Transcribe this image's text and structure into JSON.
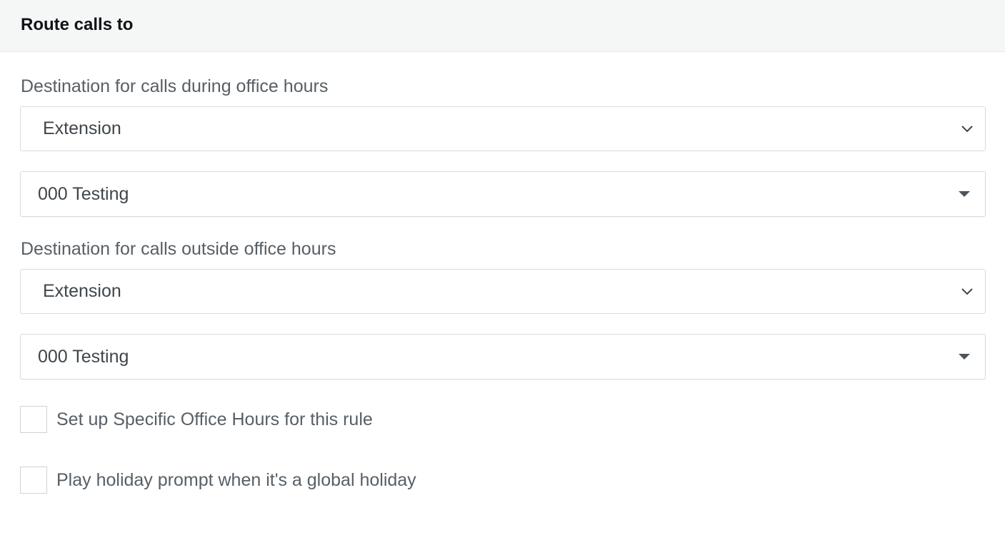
{
  "header": {
    "title": "Route calls to"
  },
  "office_hours": {
    "label": "Destination for calls during office hours",
    "type_value": "Extension",
    "target_value": "000 Testing"
  },
  "outside_hours": {
    "label": "Destination for calls outside office hours",
    "type_value": "Extension",
    "target_value": "000 Testing"
  },
  "options": {
    "specific_hours_label": "Set up Specific Office Hours for this rule",
    "specific_hours_checked": false,
    "holiday_prompt_label": "Play holiday prompt when it's a global holiday",
    "holiday_prompt_checked": false
  },
  "icons": {
    "type_dropdown": "chevron-down-icon",
    "target_dropdown": "caret-down-icon"
  },
  "colors": {
    "header_bg": "#f5f6f6",
    "text": "#575f65",
    "border": "#d7dadc"
  }
}
